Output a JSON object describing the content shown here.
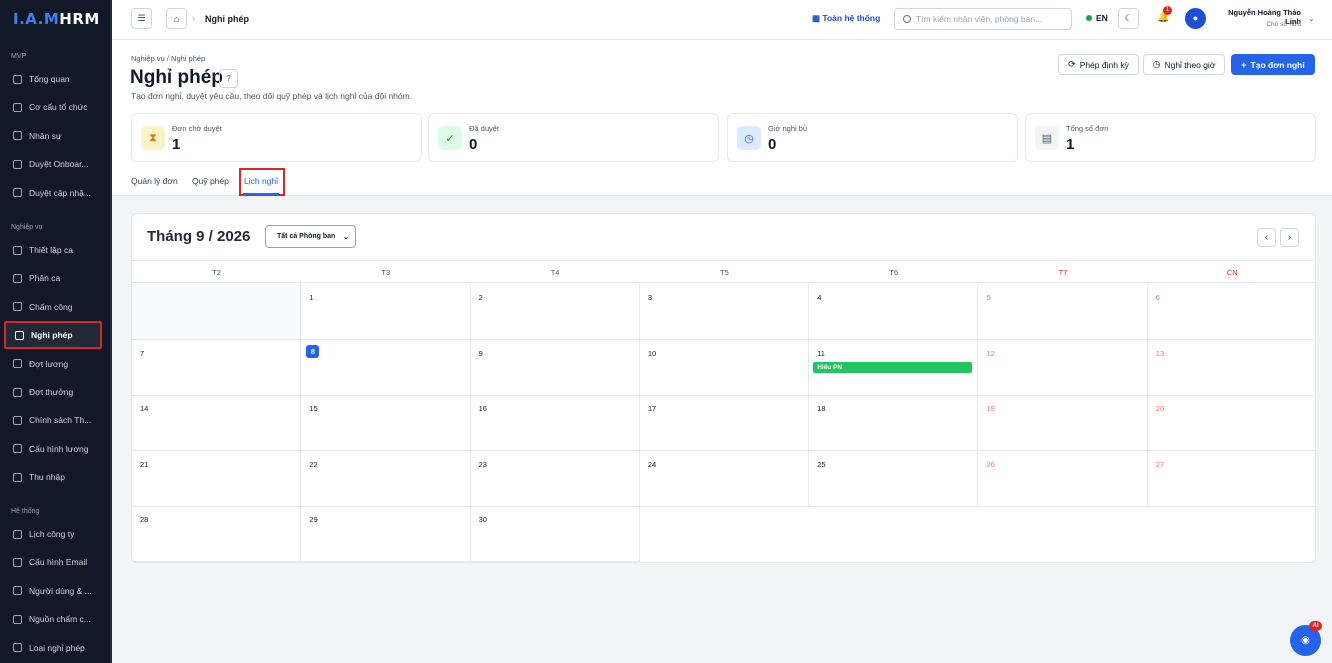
{
  "app": {
    "logo_prefix": "I.A.M",
    "logo_suffix": "HRM"
  },
  "sidebar": {
    "sections": [
      {
        "title": "MVP",
        "items": [
          {
            "label": "Tổng quan",
            "icon": "building-icon"
          },
          {
            "label": "Cơ cấu tổ chức",
            "icon": "org-chart-icon"
          },
          {
            "label": "Nhân sự",
            "icon": "users-icon"
          },
          {
            "label": "Duyệt Onboar...",
            "icon": "check-circle-icon"
          },
          {
            "label": "Duyệt cập nhậ...",
            "icon": "check-circle-icon"
          }
        ]
      },
      {
        "title": "Nghiệp vụ",
        "items": [
          {
            "label": "Thiết lập ca",
            "icon": "clock-icon"
          },
          {
            "label": "Phân ca",
            "icon": "calendar-icon"
          },
          {
            "label": "Chấm công",
            "icon": "check-circle-icon"
          },
          {
            "label": "Nghỉ phép",
            "icon": "calendar-icon",
            "active": true
          },
          {
            "label": "Đợt lương",
            "icon": "dollar-icon"
          },
          {
            "label": "Đợt thưởng",
            "icon": "gift-icon"
          },
          {
            "label": "Chính sách Th...",
            "icon": "settings-icon"
          },
          {
            "label": "Cấu hình lương",
            "icon": "settings-icon"
          },
          {
            "label": "Thu nhập",
            "icon": "wallet-icon"
          }
        ]
      },
      {
        "title": "Hệ thống",
        "items": [
          {
            "label": "Lịch công ty",
            "icon": "calendar-icon"
          },
          {
            "label": "Cấu hình Email",
            "icon": "mail-icon"
          },
          {
            "label": "Người dùng & ...",
            "icon": "shield-icon"
          },
          {
            "label": "Nguồn chấm c...",
            "icon": "settings-icon"
          },
          {
            "label": "Loại nghỉ phép",
            "icon": "calendar-icon"
          }
        ]
      }
    ]
  },
  "topbar": {
    "breadcrumb": "Nghỉ phép",
    "scope_label": "Toàn hệ thống",
    "search_placeholder": "Tìm kiếm nhân viên, phòng ban...",
    "language": "EN",
    "notification_count": "1",
    "user_name": "Nguyễn Hoàng Thảo Linh",
    "user_role": "Chủ sở hữu"
  },
  "page": {
    "breadcrumb": "Nghiệp vụ / Nghỉ phép",
    "title": "Nghỉ phép",
    "description": "Tạo đơn nghỉ, duyệt yêu cầu, theo dõi quỹ phép và lịch nghỉ của đội nhóm.",
    "buttons": {
      "periodic": "Phép định kỳ",
      "hourly": "Nghỉ theo giờ",
      "create": "Tạo đơn nghỉ"
    }
  },
  "stats": [
    {
      "label": "Đơn chờ duyệt",
      "value": "1",
      "icon": "hourglass-icon",
      "color": "#d97706",
      "bg": "#fef3c7"
    },
    {
      "label": "Đã duyệt",
      "value": "0",
      "icon": "check-circle-icon",
      "color": "#16a34a",
      "bg": "#dcfce7"
    },
    {
      "label": "Giờ nghỉ bù",
      "value": "0",
      "icon": "clock-icon",
      "color": "#2563eb",
      "bg": "#dbeafe"
    },
    {
      "label": "Tổng số đơn",
      "value": "1",
      "icon": "document-icon",
      "color": "#4b5563",
      "bg": "#f3f4f6"
    }
  ],
  "tabs": {
    "manage": "Quản lý đơn",
    "fund": "Quỹ phép",
    "calendar": "Lịch nghỉ"
  },
  "calendar": {
    "month_label": "Tháng 9 / 2026",
    "department_filter": "Tất cả Phòng ban",
    "weekdays": [
      "T2",
      "T3",
      "T4",
      "T5",
      "T6",
      "T7",
      "CN"
    ],
    "weeks": [
      [
        null,
        "1",
        "2",
        "3",
        "4",
        "5",
        "6"
      ],
      [
        "7",
        "8",
        "9",
        "10",
        "11",
        "12",
        "13"
      ],
      [
        "14",
        "15",
        "16",
        "17",
        "18",
        "19",
        "20"
      ],
      [
        "21",
        "22",
        "23",
        "24",
        "25",
        "26",
        "27"
      ],
      [
        "28",
        "29",
        "30",
        null,
        null,
        null,
        null
      ]
    ],
    "today": "8",
    "events": [
      {
        "day": "11",
        "label": "Hiếu PN",
        "color": "#22c55e"
      }
    ]
  },
  "fab": {
    "badge": "AI"
  }
}
